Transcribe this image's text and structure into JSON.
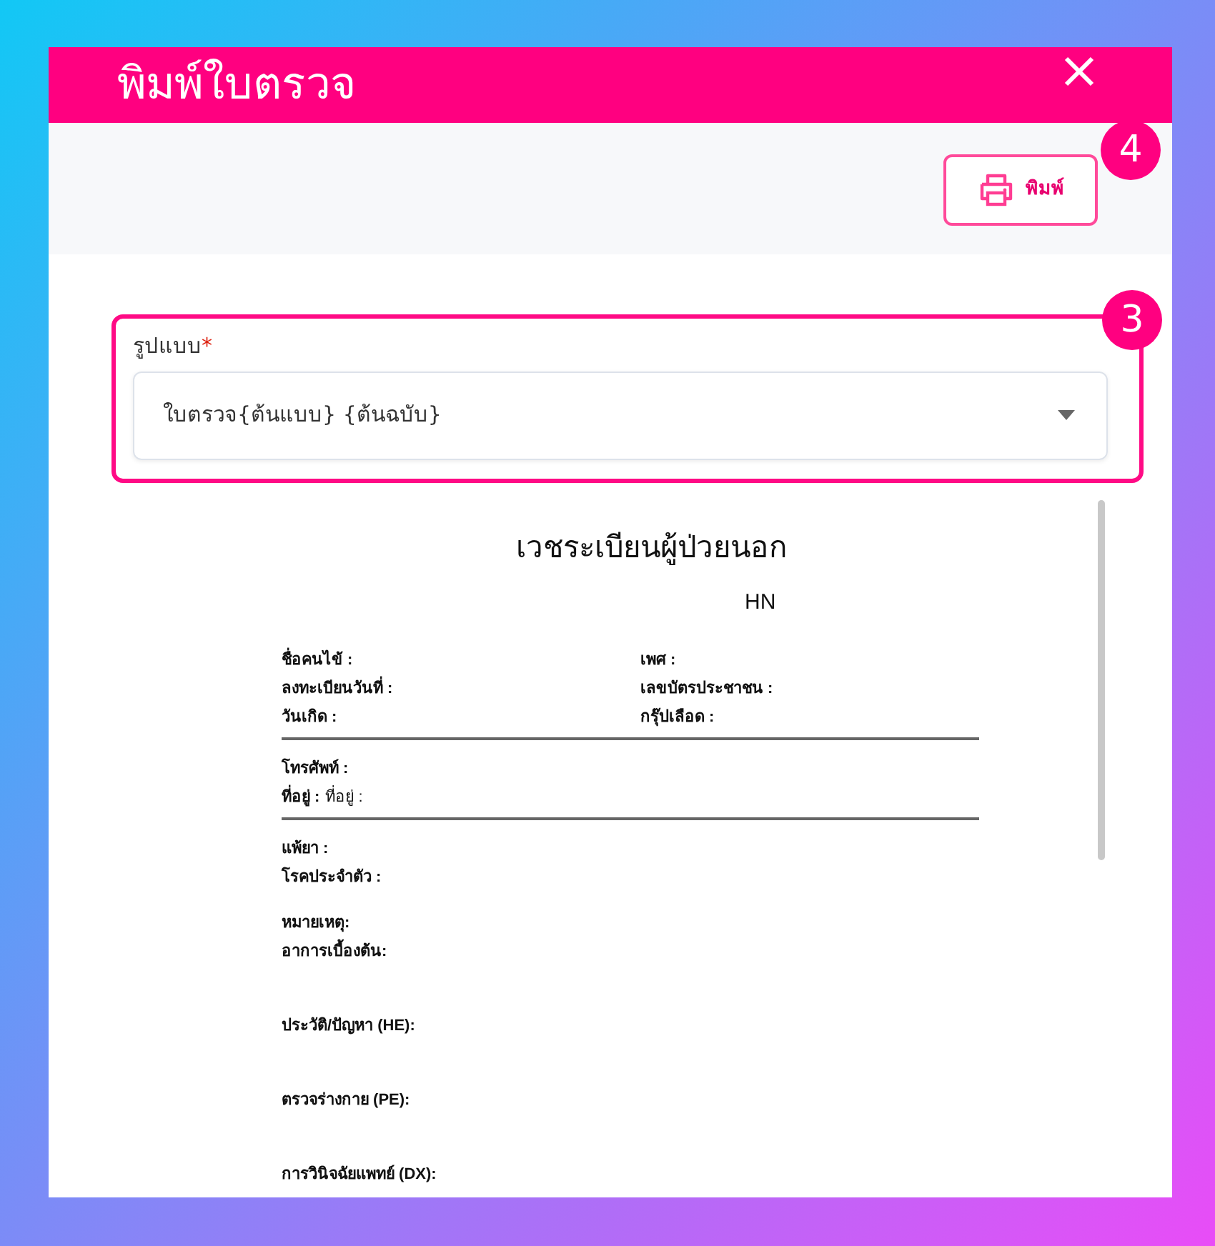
{
  "dialog": {
    "title": "พิมพ์ใบตรวจ"
  },
  "print_button": {
    "label": "พิมพ์",
    "callout": "4"
  },
  "format_field": {
    "label": "รูปแบบ",
    "required_mark": "*",
    "value": "ใบตรวจ{ต้นแบบ} {ต้นฉบับ}",
    "callout": "3"
  },
  "document": {
    "title": "เวชระเบียนผู้ป่วยนอก",
    "hn_label": "HN",
    "info_rows": [
      {
        "left": "ชื่อคนไข้ :",
        "right": "เพศ :"
      },
      {
        "left": "ลงทะเบียนวันที่ :",
        "right": "เลขบัตรประชาชน :"
      },
      {
        "left": "วันเกิด :",
        "right": "กรุ๊ปเลือด :"
      }
    ],
    "contact_rows": [
      {
        "label": "โทรศัพท์ :"
      },
      {
        "label": "ที่อยู่ :",
        "value": "ที่อยู่ :"
      }
    ],
    "fields": [
      {
        "kind": "line",
        "label": "แพ้ยา :"
      },
      {
        "kind": "line",
        "label": "โรคประจำตัว :"
      },
      {
        "kind": "group",
        "label": "หมายเหตุ:"
      },
      {
        "kind": "line",
        "label": "อาการเบื้องต้น:"
      },
      {
        "kind": "section",
        "label": "ประวัติ/ปัญหา (HE):"
      },
      {
        "kind": "section",
        "label": "ตรวจร่างกาย (PE):"
      },
      {
        "kind": "section",
        "label": "การวินิจฉัยแพทย์ (DX):"
      }
    ]
  }
}
